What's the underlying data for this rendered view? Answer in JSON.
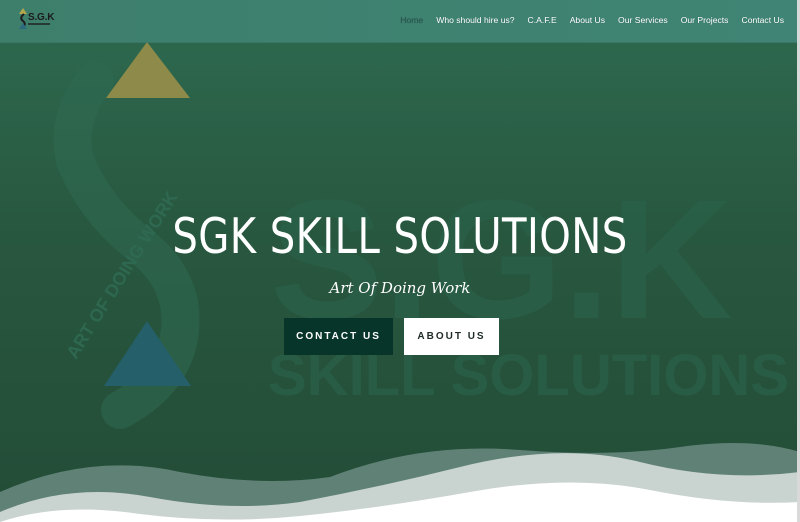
{
  "header": {
    "logo_text": "S.G.K",
    "nav": [
      {
        "label": "Home",
        "active": true
      },
      {
        "label": "Who should hire us?",
        "active": false
      },
      {
        "label": "C.A.F.E",
        "active": false
      },
      {
        "label": "About Us",
        "active": false
      },
      {
        "label": "Our Services",
        "active": false
      },
      {
        "label": "Our Projects",
        "active": false
      },
      {
        "label": "Contact Us",
        "active": false
      }
    ]
  },
  "hero": {
    "title": "SGK SKILL SOLUTIONS",
    "subtitle": "Art Of Doing Work",
    "contact_button": "CONTACT US",
    "about_button": "ABOUT US",
    "watermark_title": "S.G.K",
    "watermark_subtitle": "SKILL SOLUTIONS",
    "watermark_tagline": "ART OF DOING WORK"
  },
  "colors": {
    "header_bg": "#3f8474",
    "hero_bg": "#28573f",
    "contact_button_bg": "#083529",
    "about_button_bg": "#ffffff",
    "triangle_top": "#8e8a4a",
    "triangle_bottom": "#255f69"
  }
}
